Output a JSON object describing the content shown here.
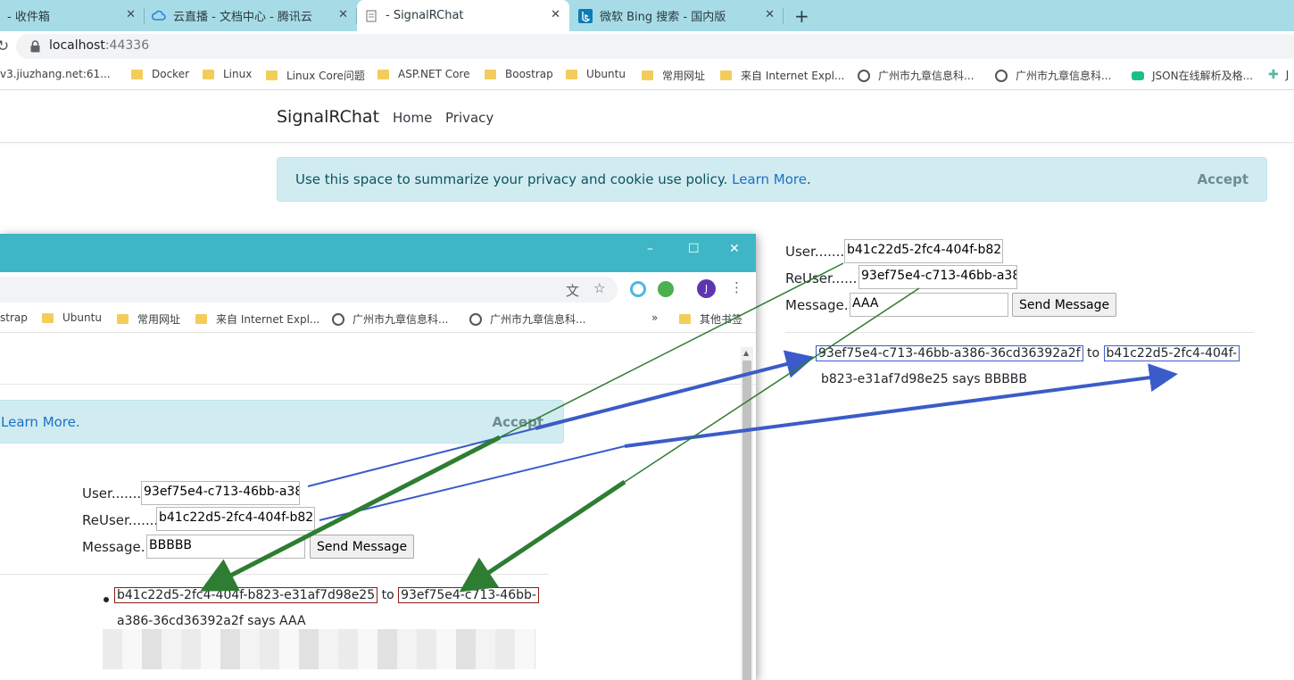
{
  "browser": {
    "tabs": [
      {
        "title": "- 收件箱"
      },
      {
        "title": "云直播 - 文档中心 - 腾讯云"
      },
      {
        "title": "- SignalRChat"
      },
      {
        "title": "微软 Bing 搜索 - 国内版"
      }
    ],
    "url_host": "localhost",
    "url_port": ":44336",
    "bookmarks": [
      {
        "label": "v3.jiuzhang.net:61...",
        "icon": "page-icon"
      },
      {
        "label": "Docker",
        "icon": "folder-icon"
      },
      {
        "label": "Linux",
        "icon": "folder-icon"
      },
      {
        "label": "Linux Core问题",
        "icon": "folder-icon"
      },
      {
        "label": "ASP.NET Core",
        "icon": "folder-icon"
      },
      {
        "label": "Boostrap",
        "icon": "folder-icon"
      },
      {
        "label": "Ubuntu",
        "icon": "folder-icon"
      },
      {
        "label": "常用网址",
        "icon": "folder-icon"
      },
      {
        "label": "来自 Internet Expl...",
        "icon": "folder-icon"
      },
      {
        "label": "广州市九章信息科...",
        "icon": "globe-icon"
      },
      {
        "label": "广州市九章信息科...",
        "icon": "globe-icon"
      },
      {
        "label": "JSON在线解析及格...",
        "icon": "json-icon"
      },
      {
        "label": "J",
        "icon": "puzzle-icon"
      }
    ]
  },
  "navbar": {
    "brand": "SignalRChat",
    "home": "Home",
    "privacy": "Privacy"
  },
  "cookie": {
    "text": "Use this space to summarize your privacy and cookie use policy. ",
    "learn_more": "Learn More",
    "period": ".",
    "accept": "Accept"
  },
  "chat_main": {
    "user_label": "User..........",
    "user_value": "b41c22d5-2fc4-404f-b82",
    "reuser_label": "ReUser..........",
    "reuser_value": "93ef75e4-c713-46bb-a38",
    "message_label": "Message...",
    "message_value": "AAA",
    "send_label": "Send Message",
    "messages": [
      {
        "from": "93ef75e4-c713-46bb-a386-36cd36392a2f",
        "to_word": "to",
        "to": "b41c22d5-2fc4-404f-",
        "rest": "b823-e31af7d98e25 says BBBBB"
      }
    ]
  },
  "window2": {
    "minimize": "–",
    "maximize": "☐",
    "close": "✕",
    "avatar_letter": "J",
    "bookmarks": [
      {
        "label": "strap",
        "icon": "none"
      },
      {
        "label": "Ubuntu",
        "icon": "folder-icon"
      },
      {
        "label": "常用网址",
        "icon": "folder-icon"
      },
      {
        "label": "来自 Internet Expl...",
        "icon": "folder-icon"
      },
      {
        "label": "广州市九章信息科...",
        "icon": "globe-icon"
      },
      {
        "label": "广州市九章信息科...",
        "icon": "globe-icon"
      },
      {
        "label": "»",
        "icon": "none"
      },
      {
        "label": "其他书签",
        "icon": "folder-icon"
      }
    ],
    "cookie_learn_more": "Learn More.",
    "cookie_accept": "Accept",
    "chat": {
      "user_label": "User..........",
      "user_value": "93ef75e4-c713-46bb-a38",
      "reuser_label": "ReUser..........",
      "reuser_value": "b41c22d5-2fc4-404f-b82",
      "message_label": "Message...",
      "message_value": "BBBBB",
      "send_label": "Send Message",
      "messages": [
        {
          "from": "b41c22d5-2fc4-404f-b823-e31af7d98e25",
          "to_word": "to",
          "to": "93ef75e4-c713-46bb-",
          "rest": "a386-36cd36392a2f says AAA"
        }
      ]
    }
  },
  "colors": {
    "accent_blue": "#3b5bc9",
    "accent_green": "#2e7d32",
    "box_red": "#8b1a1a",
    "tab_strip": "#a7dce7",
    "window_title": "#3fb6c5"
  }
}
